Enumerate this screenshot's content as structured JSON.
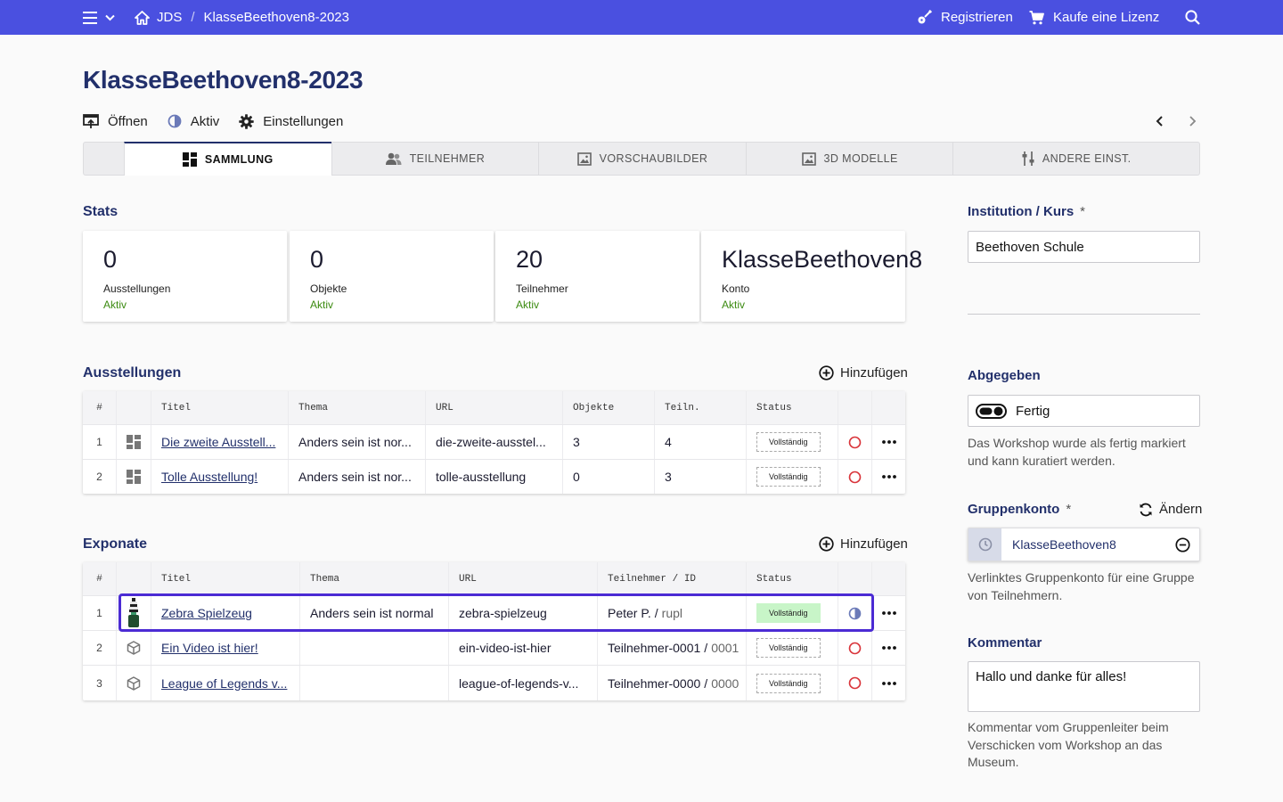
{
  "topbar": {
    "breadcrumb_root": "JDS",
    "breadcrumb_sep": "/",
    "breadcrumb_current": "KlasseBeethoven8-2023",
    "register_label": "Registrieren",
    "license_label": "Kaufe eine Lizenz"
  },
  "page": {
    "title": "KlasseBeethoven8-2023",
    "actions": {
      "open": "Öffnen",
      "active": "Aktiv",
      "settings": "Einstellungen"
    }
  },
  "tabs": [
    "SAMMLUNG",
    "TEILNEHMER",
    "VORSCHAUBILDER",
    "3D MODELLE",
    "ANDERE EINST."
  ],
  "stats": {
    "title": "Stats",
    "cards": [
      {
        "value": "0",
        "label": "Ausstellungen",
        "status": "Aktiv"
      },
      {
        "value": "0",
        "label": "Objekte",
        "status": "Aktiv"
      },
      {
        "value": "20",
        "label": "Teilnehmer",
        "status": "Aktiv"
      },
      {
        "value": "KlasseBeethoven8",
        "label": "Konto",
        "status": "Aktiv"
      }
    ]
  },
  "ausstellungen": {
    "title": "Ausstellungen",
    "add_label": "Hinzufügen",
    "headers": [
      "#",
      "Titel",
      "Thema",
      "URL",
      "Objekte",
      "Teiln.",
      "Status"
    ],
    "rows": [
      {
        "n": "1",
        "title": "Die zweite Ausstell...",
        "theme": "Anders sein ist nor...",
        "url": "die-zweite-ausstel...",
        "objects": "3",
        "participants": "4",
        "status": "Vollständig"
      },
      {
        "n": "2",
        "title": "Tolle Ausstellung!",
        "theme": "Anders sein ist nor...",
        "url": "tolle-ausstellung",
        "objects": "0",
        "participants": "3",
        "status": "Vollständig"
      }
    ]
  },
  "exponate": {
    "title": "Exponate",
    "add_label": "Hinzufügen",
    "headers": [
      "#",
      "Titel",
      "Thema",
      "URL",
      "Teilnehmer / ID",
      "Status"
    ],
    "rows": [
      {
        "n": "1",
        "title": "Zebra Spielzeug",
        "theme": "Anders sein ist normal",
        "url": "zebra-spielzeug",
        "participant": "Peter P.",
        "sep": "/",
        "id": "rupl",
        "status": "Vollständig"
      },
      {
        "n": "2",
        "title": "Ein Video ist hier!",
        "theme": "",
        "url": "ein-video-ist-hier",
        "participant": "Teilnehmer-0001",
        "sep": "/",
        "id": "0001",
        "status": "Vollständig"
      },
      {
        "n": "3",
        "title": "League of Legends v...",
        "theme": "",
        "url": "league-of-legends-v...",
        "participant": "Teilnehmer-0000",
        "sep": "/",
        "id": "0000",
        "status": "Vollständig"
      }
    ]
  },
  "sidebar": {
    "institution_label": "Institution / Kurs",
    "required_mark": "*",
    "institution_value": "Beethoven Schule",
    "submitted_label": "Abgegeben",
    "submitted_toggle_label": "Fertig",
    "submitted_help": "Das Workshop wurde als fertig markiert und kann kuratiert werden.",
    "group_label": "Gruppenkonto",
    "change_label": "Ändern",
    "group_value": "KlasseBeethoven8",
    "group_help": "Verlinktes Gruppenkonto für eine Gruppe von Teilnehmern.",
    "comment_label": "Kommentar",
    "comment_value": "Hallo und danke für alles!",
    "comment_help": "Kommentar vom Gruppenleiter beim Verschicken vom Workshop an das Museum."
  },
  "colors": {
    "topbar": "#4a50e0",
    "heading": "#22306b",
    "active_status": "#3b8a10",
    "selection": "#4b2bd4",
    "complete_badge": "#c8f5c8",
    "status_ring": "#d9343a"
  }
}
